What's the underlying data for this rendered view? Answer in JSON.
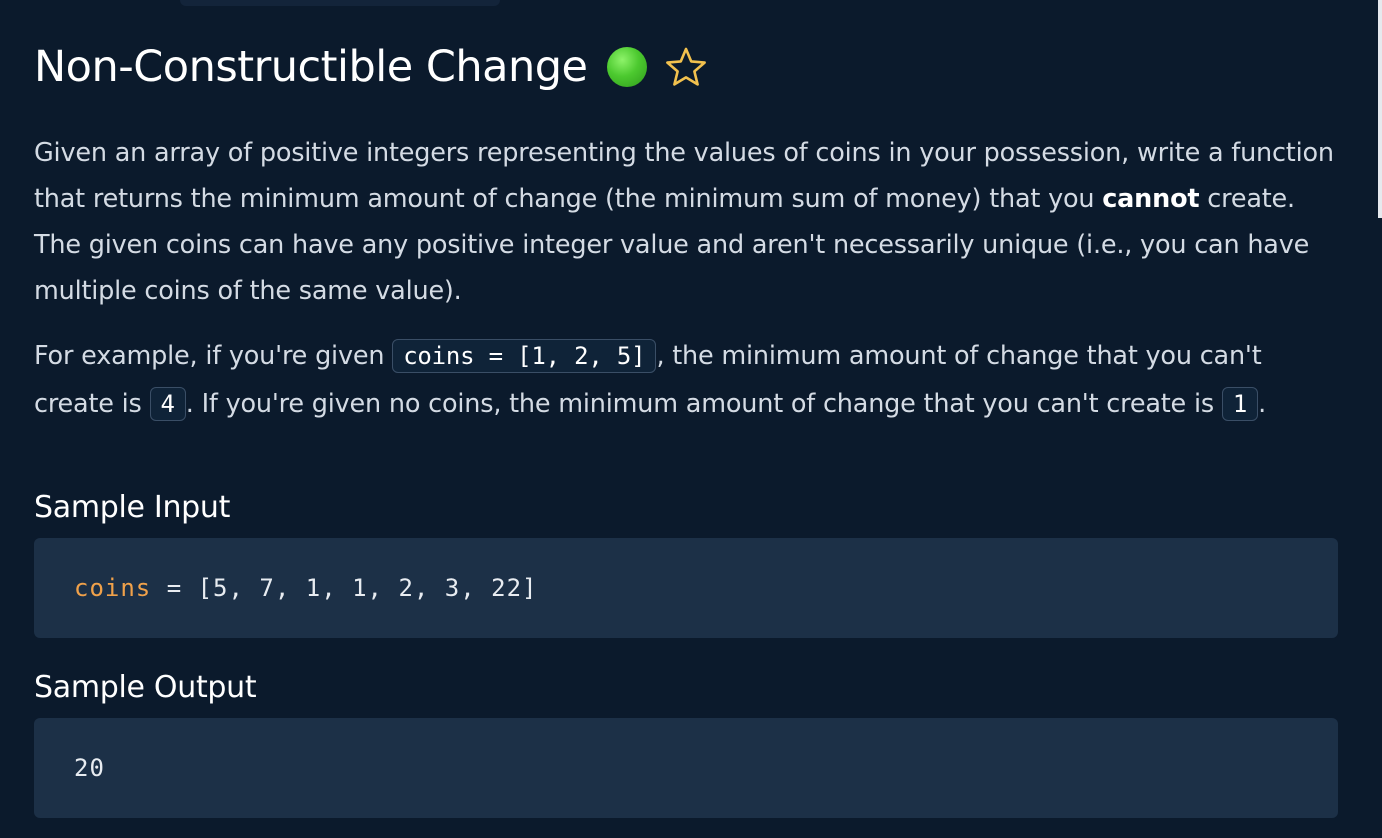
{
  "problem": {
    "title": "Non-Constructible Change",
    "difficulty_color": "#4cc92f",
    "favorite_icon": "star-icon"
  },
  "description": {
    "p1_a": "Given an array of positive integers representing the values of coins in your possession, write a function that returns the minimum amount of change (the minimum sum of money) that you ",
    "p1_bold": "cannot",
    "p1_b": " create. The given coins can have any positive integer value and aren't necessarily unique (i.e., you can have multiple coins of the same value).",
    "p2_a": "For example, if you're given ",
    "p2_code1": "coins = [1, 2, 5]",
    "p2_b": ", the minimum amount of change that you can't create is ",
    "p2_code2": "4",
    "p2_c": ". If you're given no coins, the minimum amount of change that you can't create is ",
    "p2_code3": "1",
    "p2_d": "."
  },
  "sample_input": {
    "heading": "Sample Input",
    "var_name": "coins",
    "rest": " = [5, 7, 1, 1, 2, 3, 22]"
  },
  "sample_output": {
    "heading": "Sample Output",
    "value": "20"
  },
  "colors": {
    "background": "#0b1a2c",
    "code_block_bg": "#1c3047",
    "variable_accent": "#f0a14a",
    "star_outline": "#f2c14e"
  }
}
